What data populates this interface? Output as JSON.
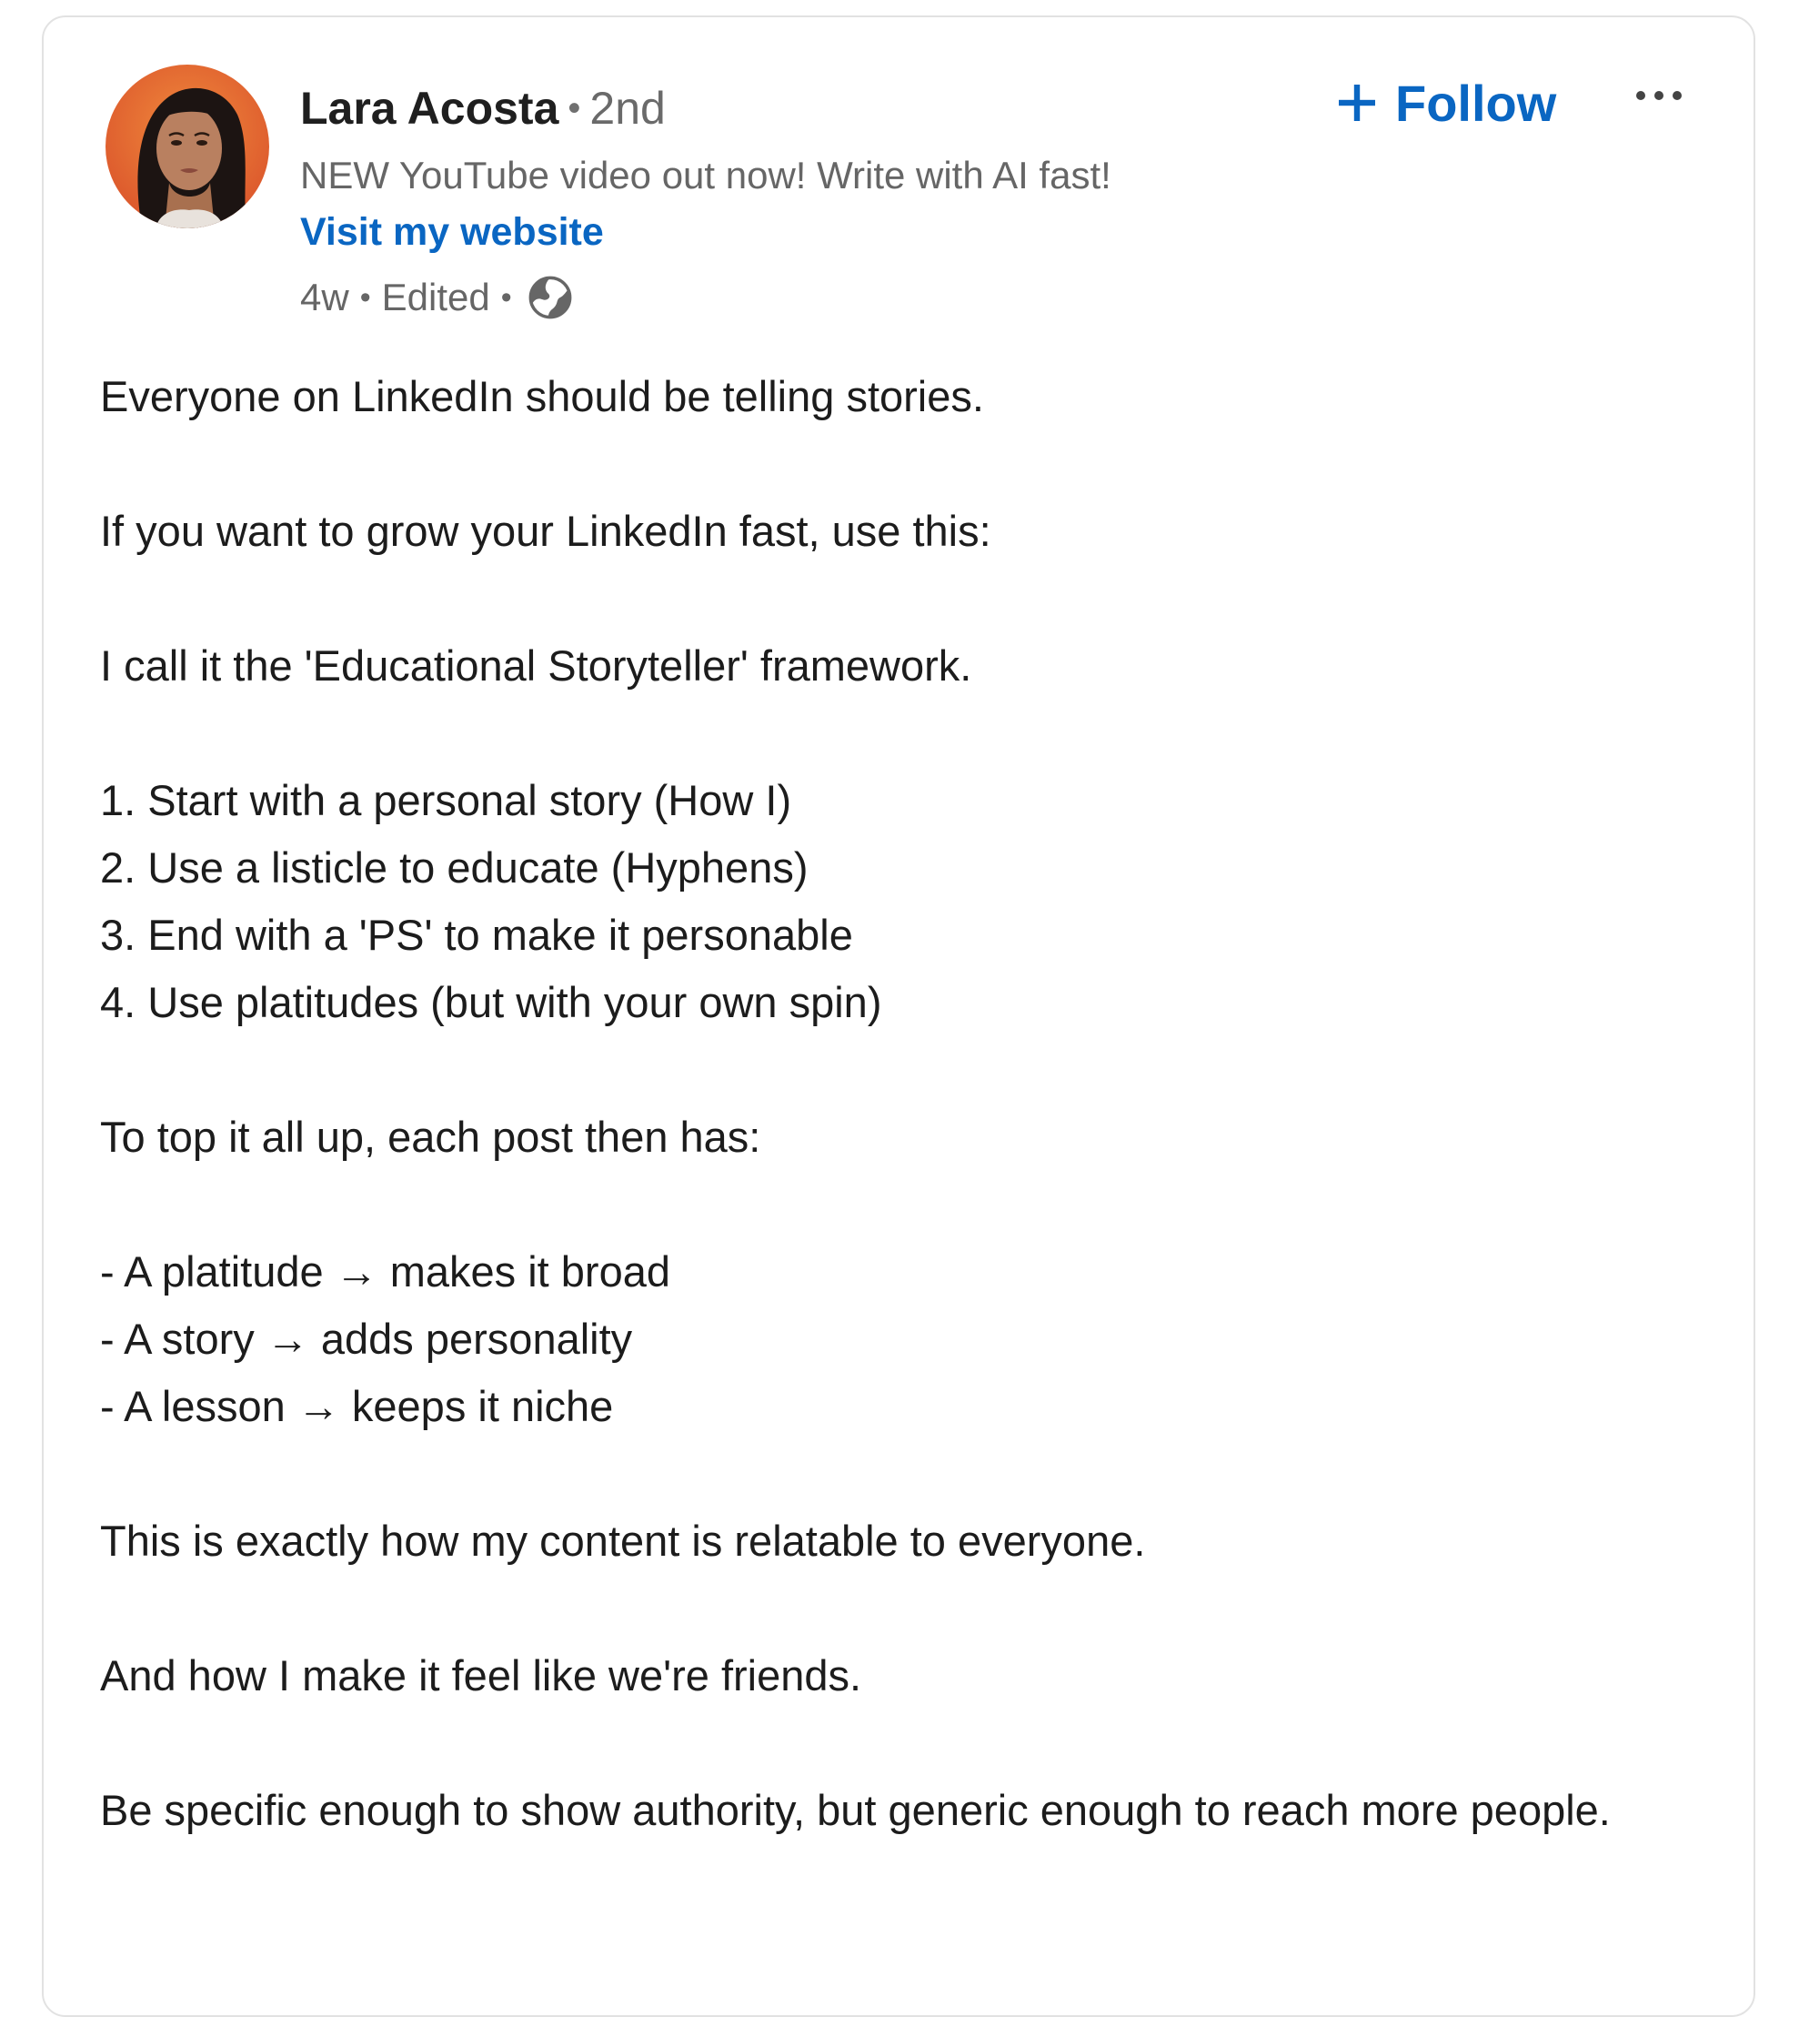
{
  "author": {
    "name": "Lara Acosta",
    "degree": "2nd",
    "separator": "•",
    "headline": "NEW YouTube video out now! Write with AI fast!",
    "website_label": "Visit my website",
    "time_ago": "4w",
    "edited_label": "Edited",
    "visibility_icon": "globe-icon"
  },
  "actions": {
    "follow_label": "Follow",
    "follow_icon": "plus-icon",
    "more_icon": "more-horizontal-icon"
  },
  "post": {
    "paragraphs": [
      [
        "Everyone on LinkedIn should be telling stories."
      ],
      [
        "If you want to grow your LinkedIn fast, use this:"
      ],
      [
        "I call it the 'Educational Storyteller' framework."
      ],
      [
        "1. Start with a personal story (How I)",
        "2. Use a listicle to educate (Hyphens)",
        "3. End with a 'PS' to make it personable",
        "4. Use platitudes (but with your own spin)"
      ],
      [
        "To top it all up, each post then has:"
      ],
      [
        "- A platitude → makes it broad",
        "- A story → adds personality",
        "- A lesson → keeps it niche"
      ],
      [
        "This is exactly how my content is relatable to everyone."
      ],
      [
        "And how I make it feel like we're friends."
      ],
      [
        "Be specific enough to show authority, but generic enough to reach more people."
      ]
    ]
  },
  "colors": {
    "link_blue": "#0a66c2",
    "text_primary": "#1c1c1c",
    "text_secondary": "#666666",
    "card_border": "#e2e2e2"
  }
}
